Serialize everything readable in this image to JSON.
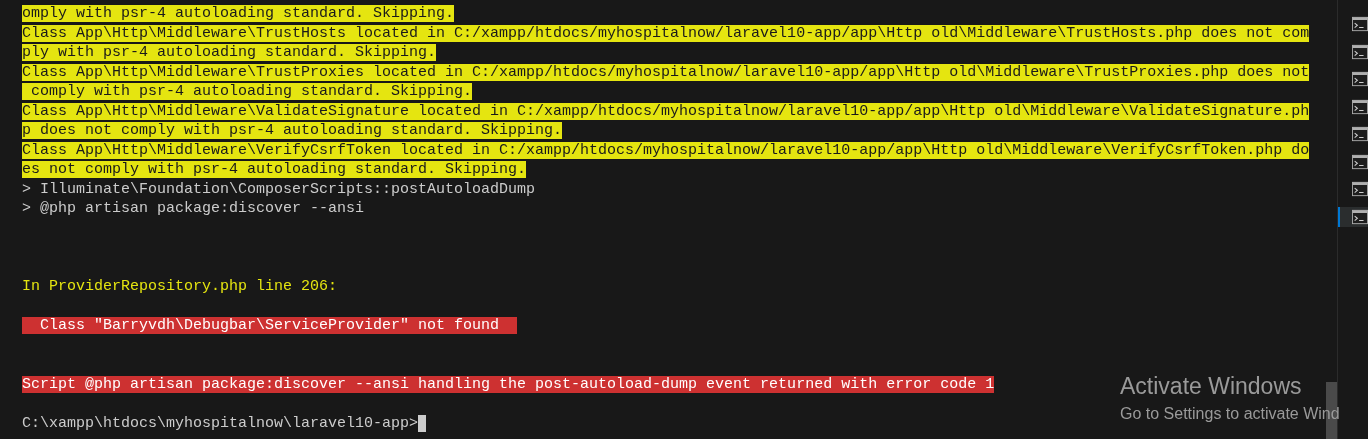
{
  "terminal": {
    "lines": [
      {
        "kind": "highlight",
        "text": "omply with psr-4 autoloading standard. Skipping."
      },
      {
        "kind": "highlight",
        "text": "Class App\\Http\\Middleware\\TrustHosts located in C:/xampp/htdocs/myhospitalnow/laravel10-app/app\\Http old\\Middleware\\TrustHosts.php does not com"
      },
      {
        "kind": "highlight",
        "text": "ply with psr-4 autoloading standard. Skipping."
      },
      {
        "kind": "highlight",
        "text": "Class App\\Http\\Middleware\\TrustProxies located in C:/xampp/htdocs/myhospitalnow/laravel10-app/app\\Http old\\Middleware\\TrustProxies.php does not"
      },
      {
        "kind": "highlight",
        "text": " comply with psr-4 autoloading standard. Skipping."
      },
      {
        "kind": "highlight",
        "text": "Class App\\Http\\Middleware\\ValidateSignature located in C:/xampp/htdocs/myhospitalnow/laravel10-app/app\\Http old\\Middleware\\ValidateSignature.ph"
      },
      {
        "kind": "highlight",
        "text": "p does not comply with psr-4 autoloading standard. Skipping."
      },
      {
        "kind": "highlight",
        "text": "Class App\\Http\\Middleware\\VerifyCsrfToken located in C:/xampp/htdocs/myhospitalnow/laravel10-app/app\\Http old\\Middleware\\VerifyCsrfToken.php do"
      },
      {
        "kind": "highlight",
        "text": "es not comply with psr-4 autoloading standard. Skipping."
      },
      {
        "kind": "plain",
        "text": "> Illuminate\\Foundation\\ComposerScripts::postAutoloadDump"
      },
      {
        "kind": "plain",
        "text": "> @php artisan package:discover --ansi"
      },
      {
        "kind": "blank"
      },
      {
        "kind": "blank"
      },
      {
        "kind": "blank"
      },
      {
        "kind": "warning",
        "text": "In ProviderRepository.php line 206:"
      },
      {
        "kind": "blank"
      },
      {
        "kind": "error",
        "text": "  Class \"Barryvdh\\Debugbar\\ServiceProvider\" not found  "
      },
      {
        "kind": "blank"
      },
      {
        "kind": "blank"
      },
      {
        "kind": "error",
        "text": "Script @php artisan package:discover --ansi handling the post-autoload-dump event returned with error code 1"
      },
      {
        "kind": "blank"
      },
      {
        "kind": "prompt",
        "text": "C:\\xampp\\htdocs\\myhospitalnow\\laravel10-app>"
      }
    ]
  },
  "terminal_tabs": [
    {
      "selected": false
    },
    {
      "selected": false
    },
    {
      "selected": false
    },
    {
      "selected": false
    },
    {
      "selected": false
    },
    {
      "selected": false
    },
    {
      "selected": false
    },
    {
      "selected": true
    }
  ],
  "activation_notice": {
    "title": "Activate Windows",
    "subtitle": "Go to Settings to activate Wind"
  }
}
